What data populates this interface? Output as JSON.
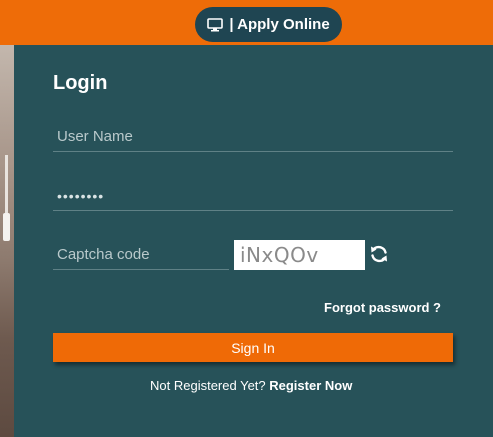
{
  "header": {
    "apply_label": "| Apply Online",
    "apply_icon": "desktop-monitor-icon",
    "brand_color": "#ee6c08"
  },
  "login": {
    "title": "Login",
    "username_placeholder": "User Name",
    "username_value": "",
    "password_value": "password",
    "captcha_placeholder": "Captcha code",
    "captcha_text": "iNxQOv",
    "refresh_icon": "refresh-icon",
    "forgot_label": "Forgot password ?",
    "signin_label": "Sign In",
    "register_prompt": "Not Registered Yet? ",
    "register_label": "Register Now",
    "panel_color": "#275259",
    "button_color": "#ef6a06"
  }
}
